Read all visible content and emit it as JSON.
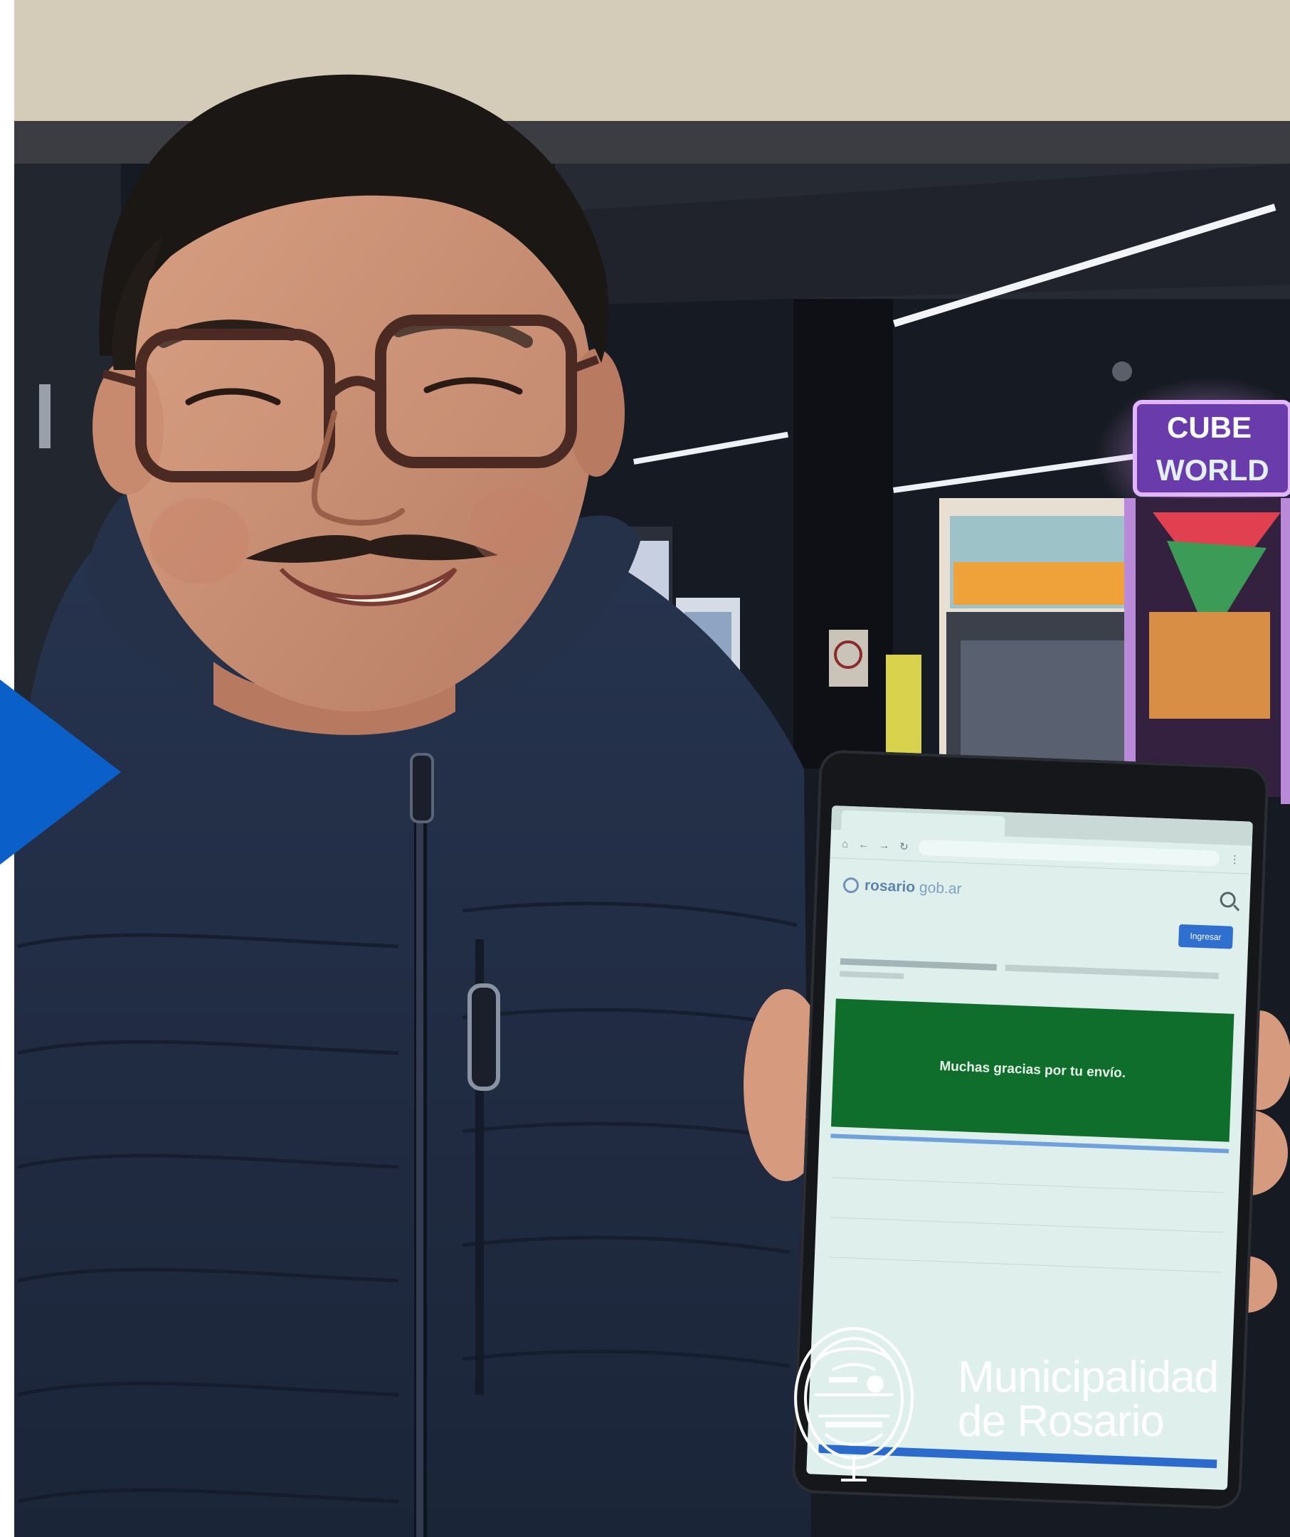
{
  "overlay": {
    "play_arrow_color": "#0b5fc9"
  },
  "tablet": {
    "site_name": "rosario",
    "site_name_suffix": "gob.ar",
    "button_label": "Ingresar",
    "success_message": "Muchas gracias por tu envío."
  },
  "branding": {
    "line1": "Municipalidad",
    "line2": "de Rosario",
    "seal_icon": "rosario-coat-of-arms-seal"
  }
}
